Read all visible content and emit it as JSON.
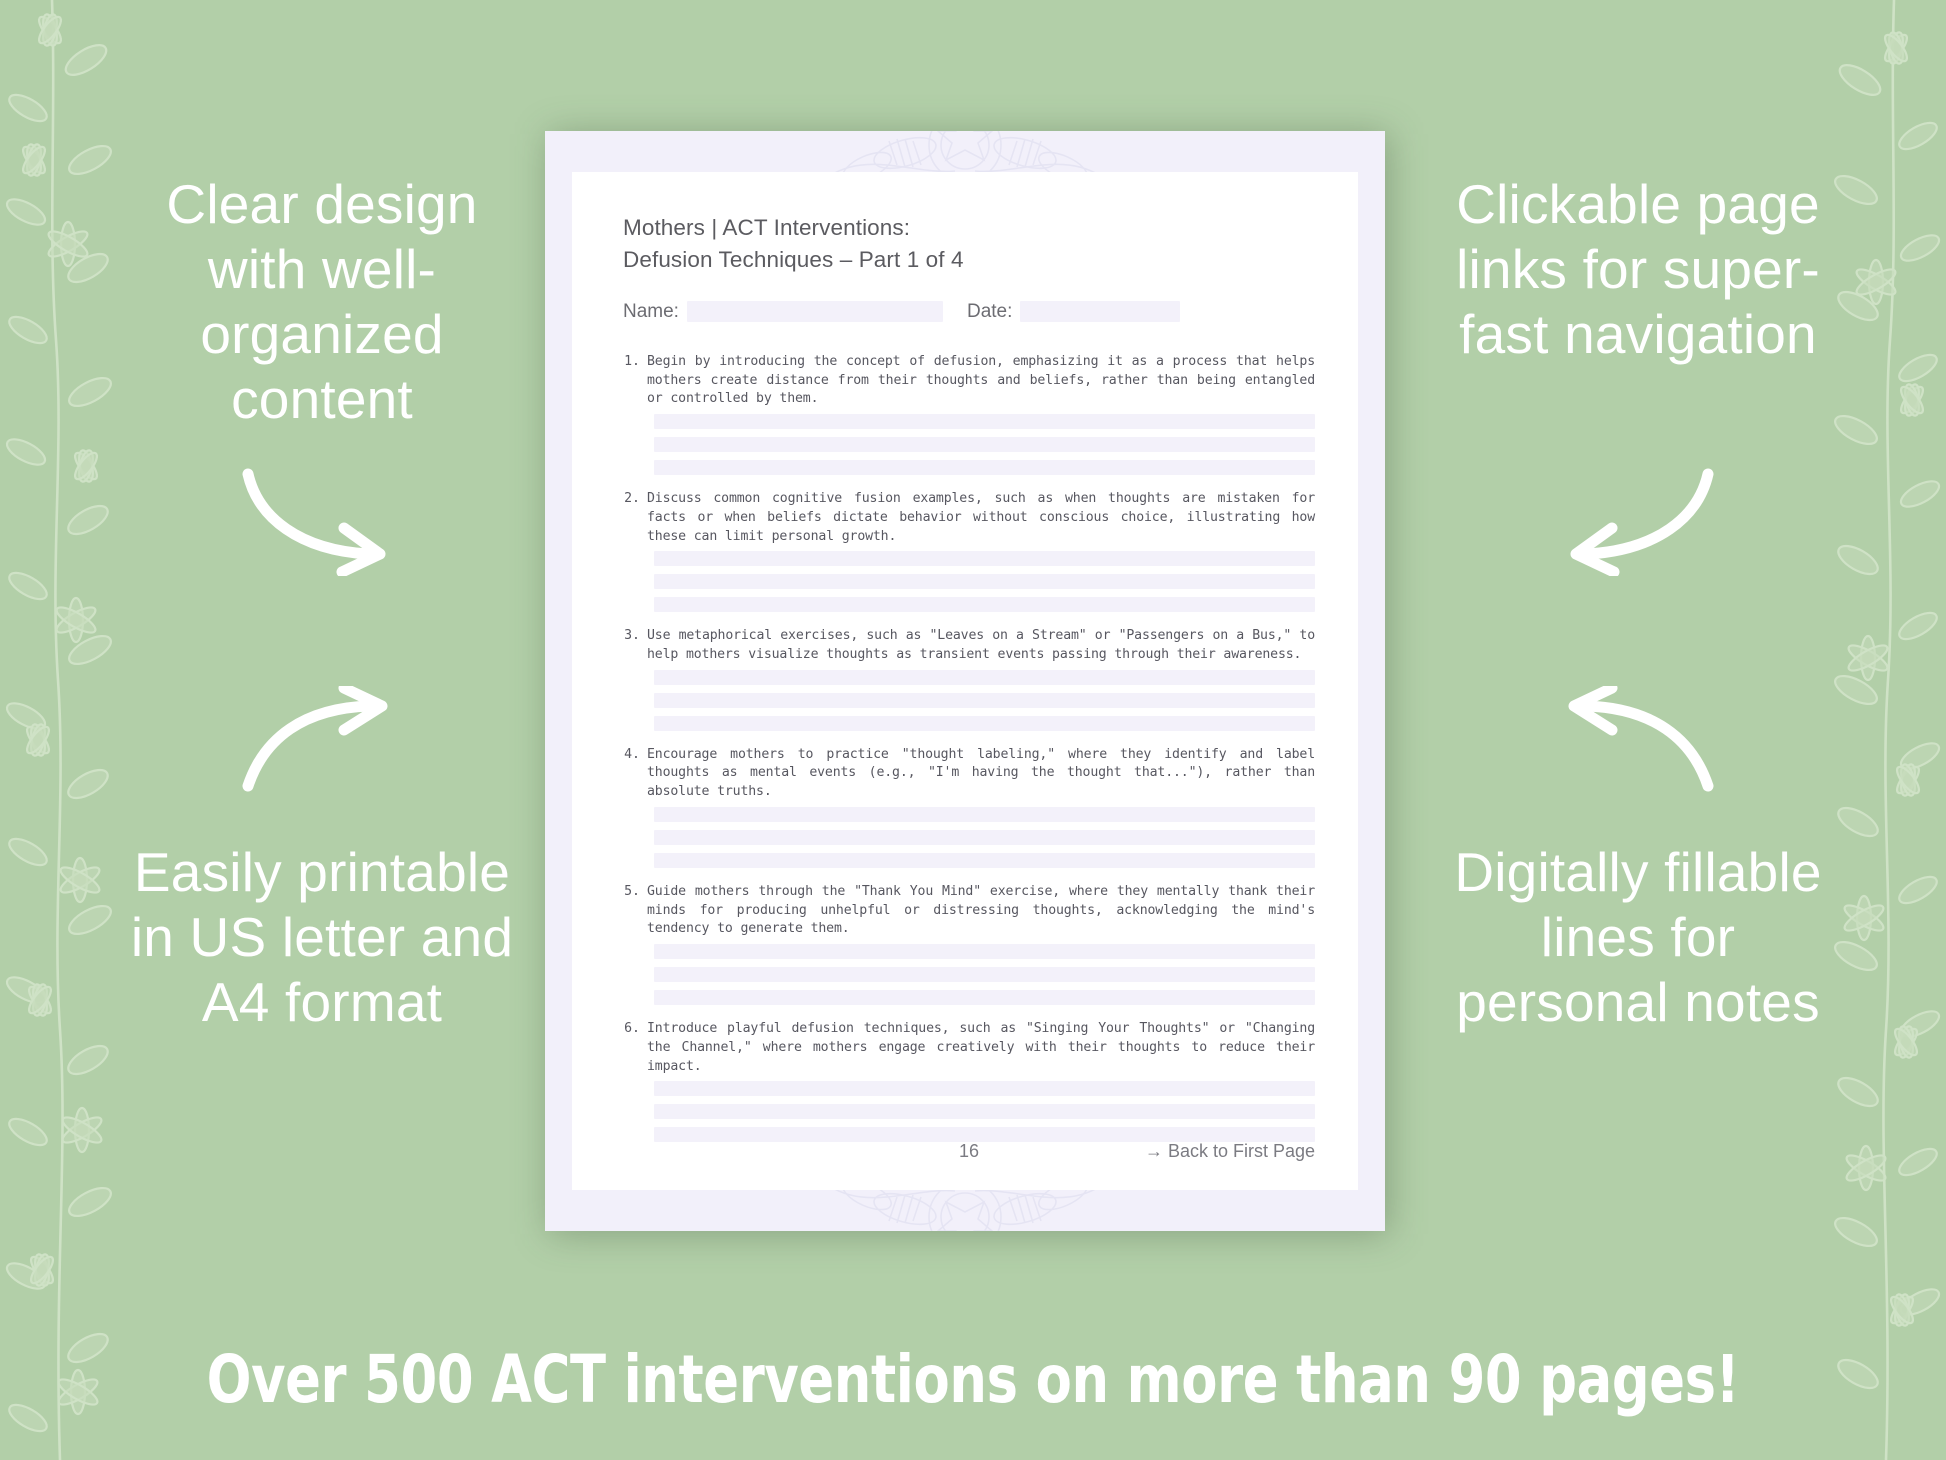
{
  "theme": {
    "background_color": "#b2cfa8",
    "page_border_color": "#f2f0fa",
    "page_color": "#ffffff",
    "fill_line_color": "#f3f1fa",
    "text_color": "#575760",
    "promo_text_color": "#ffffff"
  },
  "promo": {
    "top_left": "Clear design with well-organized content",
    "bottom_left": "Easily printable in US letter and A4 format",
    "top_right": "Clickable page links for super-fast navigation",
    "bottom_right": "Digitally fillable lines for personal notes"
  },
  "banner": {
    "text": "Over 500 ACT interventions on more than 90 pages!"
  },
  "document": {
    "title_line1": "Mothers | ACT Interventions:",
    "title_line2": "Defusion Techniques – Part 1 of 4",
    "name_label": "Name:",
    "name_value": "",
    "date_label": "Date:",
    "date_value": "",
    "items": [
      {
        "number": "1.",
        "text": "Begin by introducing the concept of defusion, emphasizing it as a process that helps mothers create distance from their thoughts and beliefs, rather than being entangled or controlled by them.",
        "fill_lines": 3
      },
      {
        "number": "2.",
        "text": "Discuss common cognitive fusion examples, such as when thoughts are mistaken for facts or when beliefs dictate behavior without conscious choice, illustrating how these can limit personal growth.",
        "fill_lines": 3
      },
      {
        "number": "3.",
        "text": "Use metaphorical exercises, such as \"Leaves on a Stream\" or \"Passengers on a Bus,\" to help mothers visualize thoughts as transient events passing through their awareness.",
        "fill_lines": 3
      },
      {
        "number": "4.",
        "text": "Encourage mothers to practice \"thought labeling,\" where they identify and label thoughts as mental events (e.g., \"I'm having the thought that...\"), rather than absolute truths.",
        "fill_lines": 3
      },
      {
        "number": "5.",
        "text": "Guide mothers through the \"Thank You Mind\" exercise, where they mentally thank their minds for producing unhelpful or distressing thoughts, acknowledging the mind's tendency to generate them.",
        "fill_lines": 3
      },
      {
        "number": "6.",
        "text": "Introduce playful defusion techniques, such as \"Singing Your Thoughts\" or \"Changing the Channel,\" where mothers engage creatively with their thoughts to reduce their impact.",
        "fill_lines": 3
      }
    ],
    "footer": {
      "page_number": "16",
      "back_link": "→ Back to First Page"
    }
  }
}
